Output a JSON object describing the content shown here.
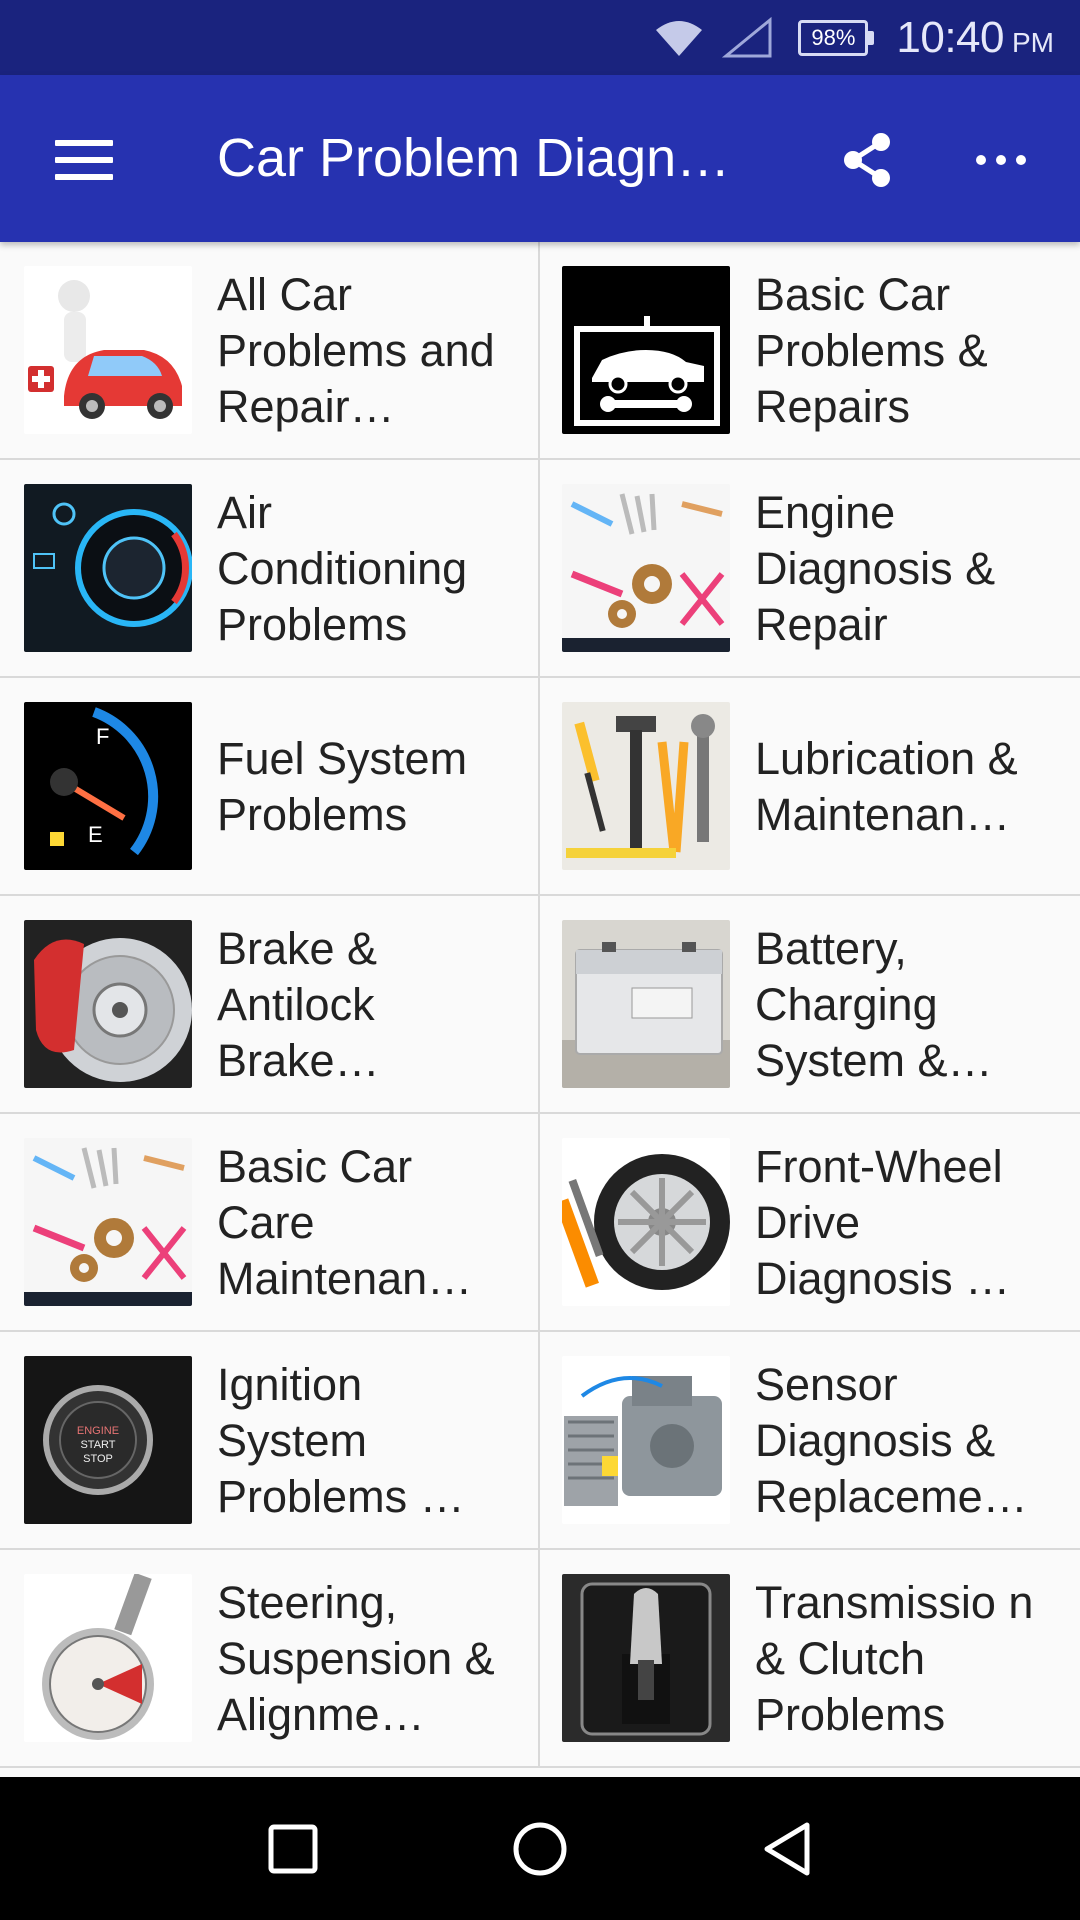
{
  "status_bar": {
    "battery_percent": "98%",
    "time": "10:40",
    "ampm": "PM",
    "icons": [
      "wifi-icon",
      "cellular-signal-icon",
      "battery-icon"
    ]
  },
  "app_bar": {
    "title": "Car Problem Diagn…",
    "icons": [
      "hamburger-menu-icon",
      "share-icon",
      "more-options-icon"
    ]
  },
  "categories": [
    {
      "label": "All Car Problems and Repair…",
      "icon": "red-car-doctor-image"
    },
    {
      "label": "Basic Car Problems & Repairs",
      "icon": "car-wrench-sign-image"
    },
    {
      "label": "Air Conditioning Problems",
      "icon": "ac-dial-image"
    },
    {
      "label": "Engine Diagnosis & Repair",
      "icon": "tools-gears-image"
    },
    {
      "label": "Fuel System Problems",
      "icon": "fuel-gauge-image"
    },
    {
      "label": "Lubrication & Maintenan…",
      "icon": "hand-tools-image"
    },
    {
      "label": "Brake & Antilock Brake…",
      "icon": "brake-disc-image"
    },
    {
      "label": "Battery, Charging System &…",
      "icon": "car-battery-image"
    },
    {
      "label": "Basic Car Care Maintenan…",
      "icon": "tools-gears-image"
    },
    {
      "label": "Front-Wheel Drive Diagnosis …",
      "icon": "wheel-wrench-image"
    },
    {
      "label": "Ignition System Problems …",
      "icon": "engine-start-button-image"
    },
    {
      "label": "Sensor Diagnosis & Replaceme…",
      "icon": "engine-block-image"
    },
    {
      "label": "Steering, Suspension & Alignme…",
      "icon": "tire-pressure-gauge-image"
    },
    {
      "label": "Transmissio n & Clutch Problems",
      "icon": "gear-shifter-image"
    }
  ],
  "nav_bar": {
    "icons": [
      "recents-square-icon",
      "home-circle-icon",
      "back-triangle-icon"
    ]
  },
  "colors": {
    "status_bar": "#1a237e",
    "app_bar": "#2632b0",
    "background": "#fafafa",
    "divider": "#d9d9d9"
  }
}
